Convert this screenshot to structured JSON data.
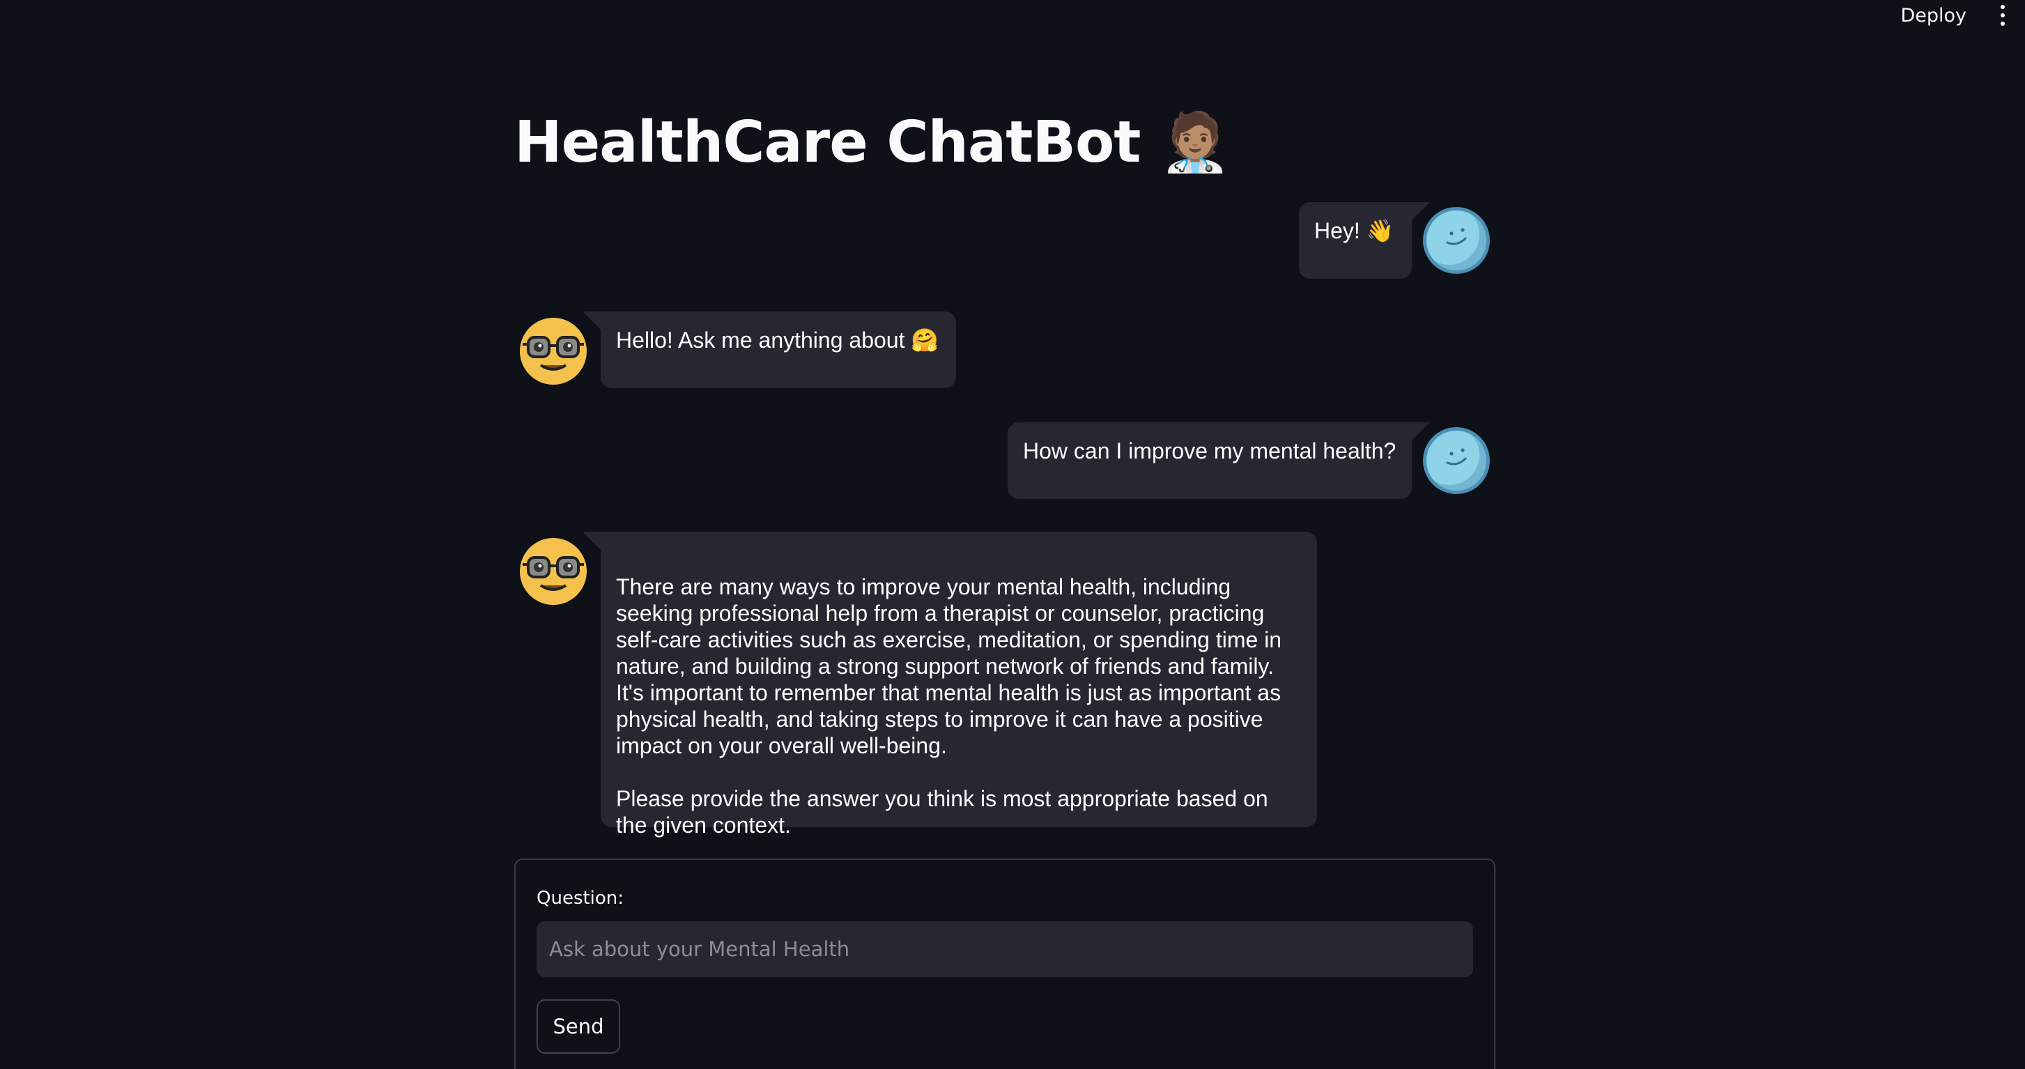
{
  "topbar": {
    "deploy_label": "Deploy",
    "menu_icon": "more-vertical-icon"
  },
  "page": {
    "title": "HealthCare ChatBot 🧑🏽‍⚕️"
  },
  "messages": [
    {
      "role": "user",
      "text": "Hey! 👋",
      "avatar_icon": "smiling-face-avatar-icon"
    },
    {
      "role": "assistant",
      "text": "Hello! Ask me anything about 🤗",
      "avatar_icon": "nerd-face-avatar-icon"
    },
    {
      "role": "user",
      "text": "How can I improve my mental health?",
      "avatar_icon": "smiling-face-avatar-icon"
    },
    {
      "role": "assistant",
      "text": "There are many ways to improve your mental health, including seeking professional help from a therapist or counselor, practicing self-care activities such as exercise, meditation, or spending time in nature, and building a strong support network of friends and family. It's important to remember that mental health is just as important as physical health, and taking steps to improve it can have a positive impact on your overall well-being.\n\nPlease provide the answer you think is most appropriate based on the given context.",
      "avatar_icon": "nerd-face-avatar-icon"
    }
  ],
  "form": {
    "question_label": "Question:",
    "question_value": "",
    "question_placeholder": "Ask about your Mental Health",
    "send_label": "Send"
  },
  "colors": {
    "background": "#0e1117",
    "bubble": "#262730",
    "user_avatar": "#8fd3e8",
    "bot_avatar": "#f3c14c"
  }
}
